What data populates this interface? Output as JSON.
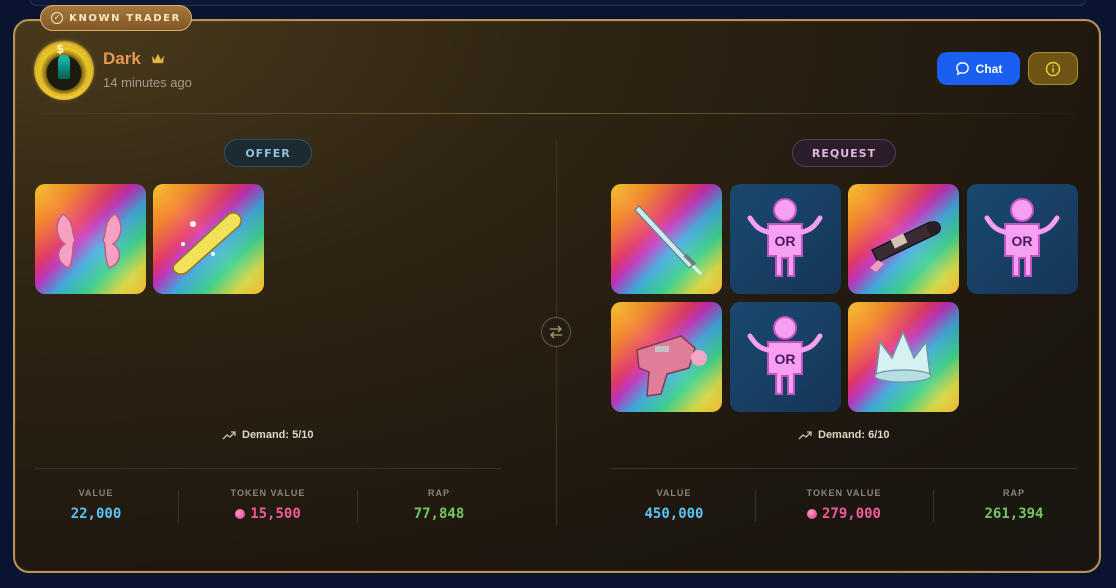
{
  "badge": {
    "label": "KNOWN TRADER"
  },
  "trader": {
    "name": "Dark",
    "time": "14 minutes ago"
  },
  "actions": {
    "chat_label": "Chat"
  },
  "offer": {
    "label": "OFFER",
    "items": [
      {
        "name": "pink-ribbon-pair",
        "kind": "rainbow"
      },
      {
        "name": "golden-scroll",
        "kind": "rainbow"
      }
    ],
    "demand": "Demand: 5/10",
    "stats": {
      "value_label": "VALUE",
      "value": "22,000",
      "token_label": "TOKEN VALUE",
      "token": "15,500",
      "rap_label": "RAP",
      "rap": "77,848"
    }
  },
  "request": {
    "label": "REQUEST",
    "items": [
      {
        "name": "ice-sword",
        "kind": "rainbow"
      },
      {
        "name": "or-placeholder",
        "kind": "or",
        "text": "OR"
      },
      {
        "name": "cannon",
        "kind": "rainbow"
      },
      {
        "name": "or-placeholder",
        "kind": "or",
        "text": "OR"
      },
      {
        "name": "pink-blaster",
        "kind": "rainbow"
      },
      {
        "name": "or-placeholder",
        "kind": "or",
        "text": "OR"
      },
      {
        "name": "ice-crown",
        "kind": "rainbow"
      }
    ],
    "demand": "Demand: 6/10",
    "stats": {
      "value_label": "VALUE",
      "value": "450,000",
      "token_label": "TOKEN VALUE",
      "token": "279,000",
      "rap_label": "RAP",
      "rap": "261,394"
    }
  },
  "colors": {
    "accent": "#1b5ff0",
    "gold": "#b8944f",
    "value": "#5ec3f5",
    "token": "#f25b99",
    "rap": "#72c764"
  }
}
